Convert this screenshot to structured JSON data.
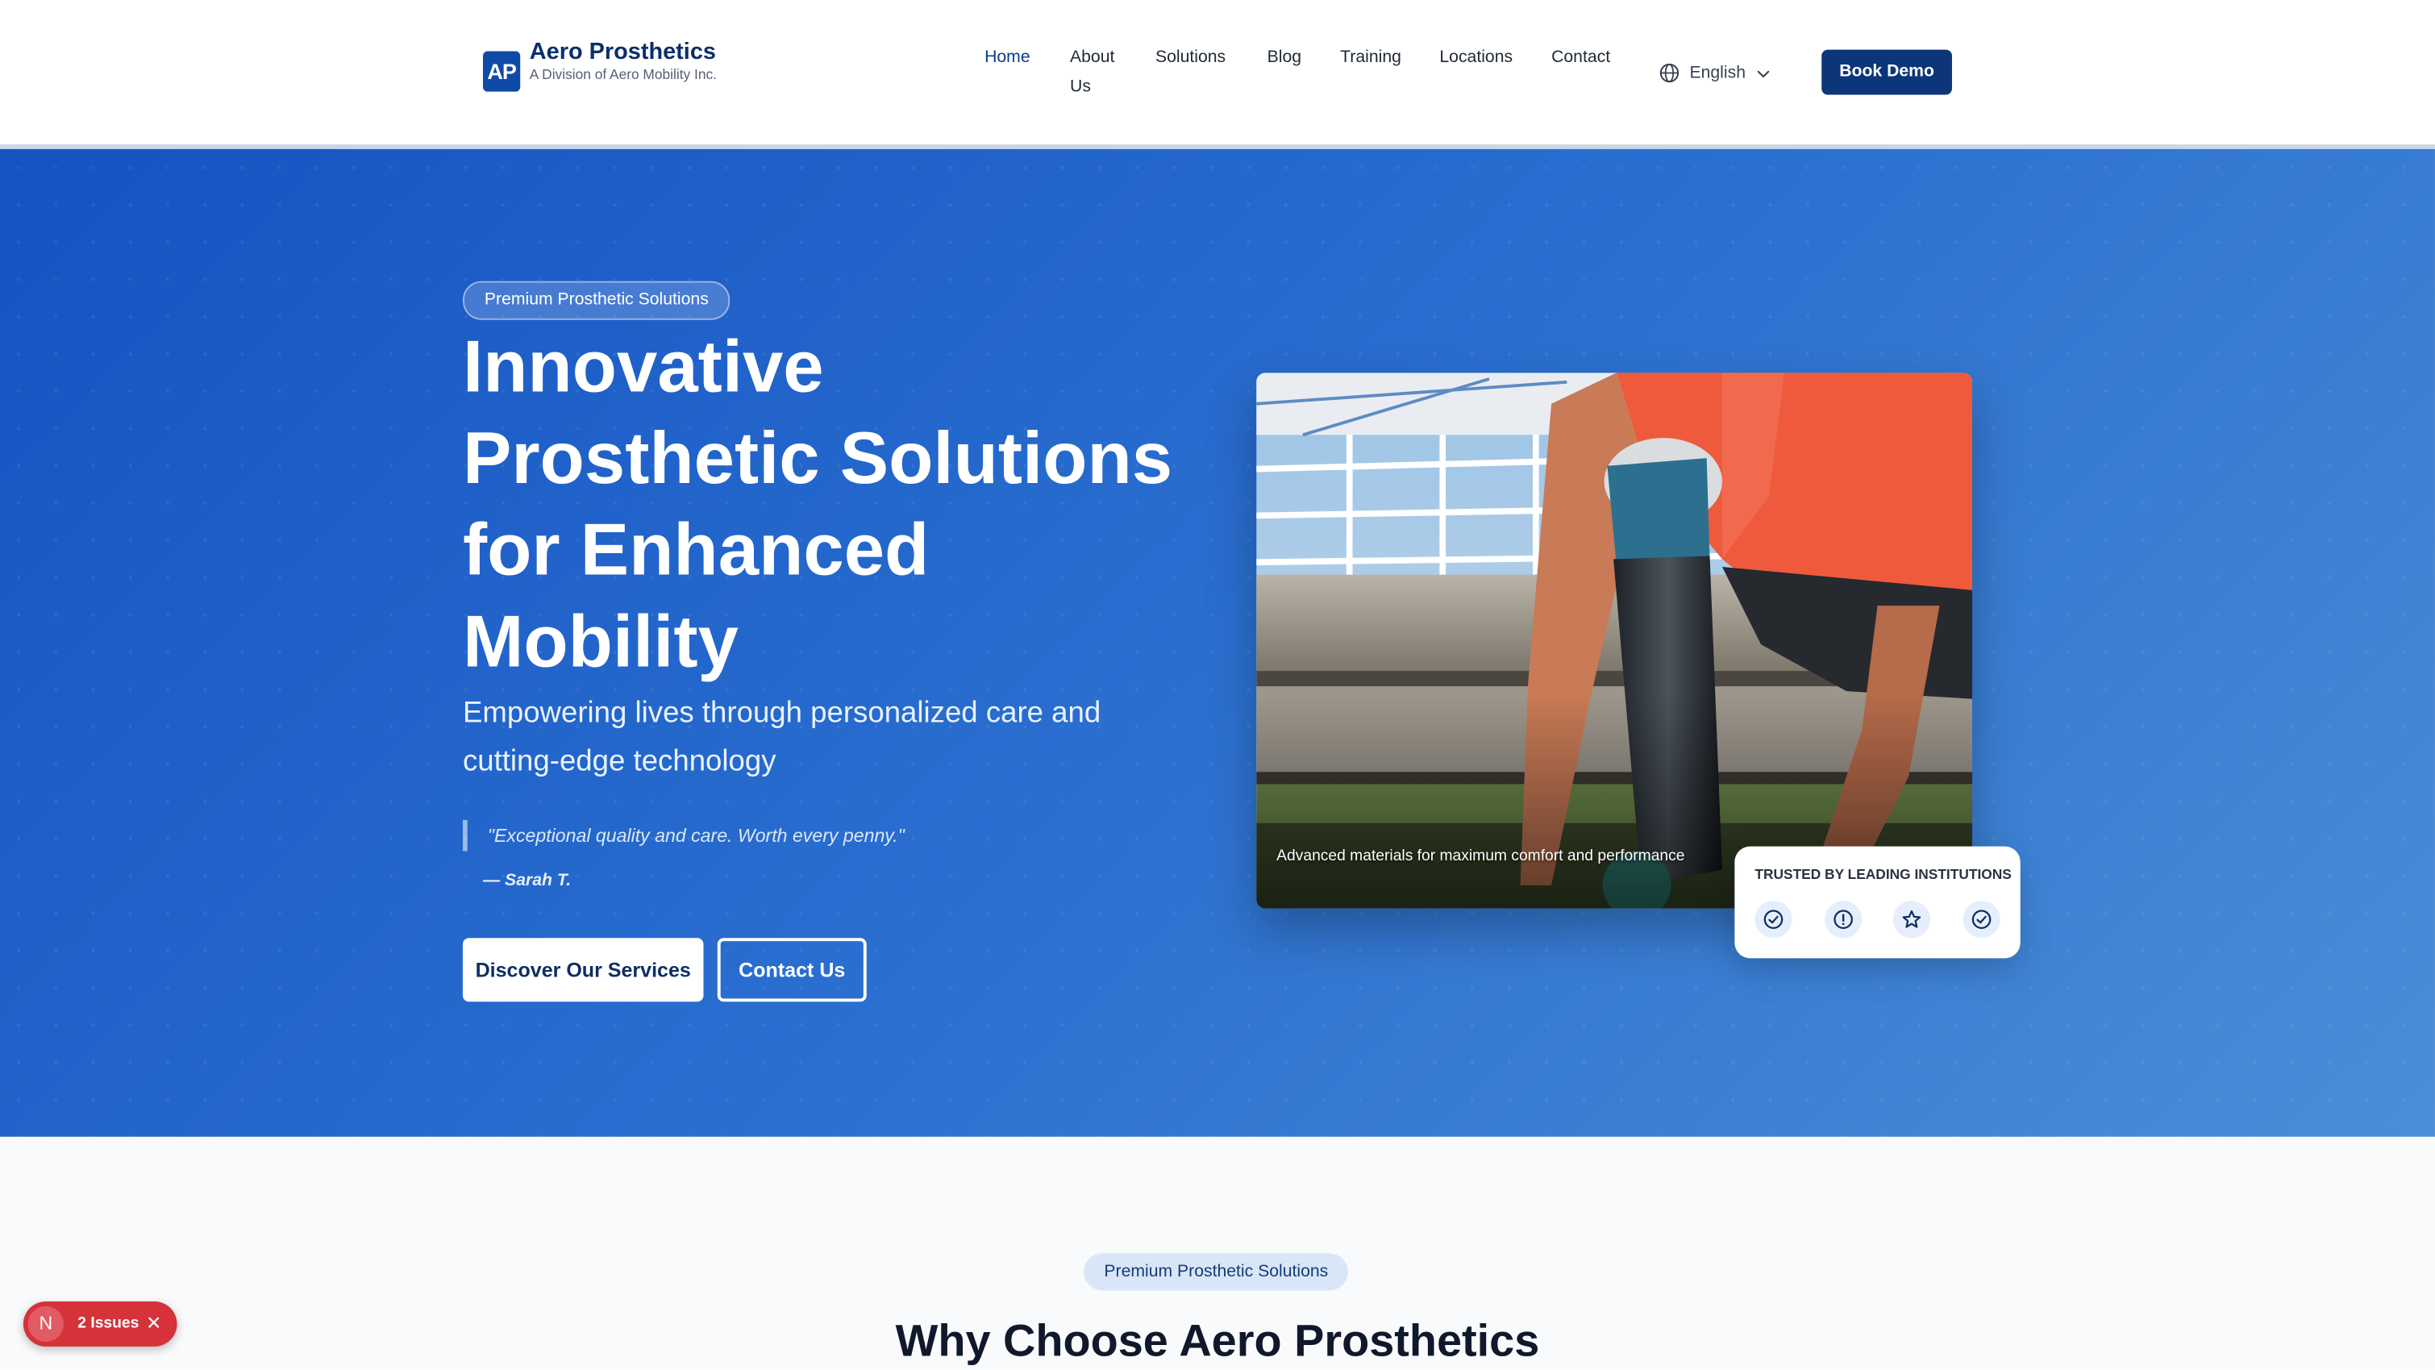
{
  "header": {
    "logo_mark": "AP",
    "brand_name": "Aero Prosthetics",
    "brand_subtitle": "A Division of Aero Mobility Inc.",
    "nav": [
      "Home",
      "About Us",
      "Solutions",
      "Blog",
      "Training",
      "Locations",
      "Contact"
    ],
    "active_nav": "Home",
    "language": "English",
    "book_demo_label": "Book Demo"
  },
  "hero": {
    "badge": "Premium Prosthetic Solutions",
    "title": "Innovative Prosthetic Solutions for Enhanced Mobility",
    "subtitle": "Empowering lives through personalized care and cutting-edge technology",
    "quote": "\"Exceptional quality and care. Worth every penny.\"",
    "quote_author": "— Sarah T.",
    "primary_button": "Discover Our Services",
    "secondary_button": "Contact Us",
    "image_caption": "Advanced materials for maximum comfort and performance",
    "trust_title": "TRUSTED BY LEADING INSTITUTIONS",
    "trust_icons": [
      "check-circle-icon",
      "info-circle-icon",
      "star-icon",
      "check-circle-icon"
    ]
  },
  "section": {
    "badge": "Premium Prosthetic Solutions",
    "title": "Why Choose Aero Prosthetics"
  },
  "dev_overlay": {
    "icon_letter": "N",
    "issues_label": "2 Issues",
    "close_glyph": "✕"
  },
  "colors": {
    "primary": "#0d357a",
    "hero_gradient_start": "#1553c1",
    "hero_gradient_end": "#4a8ed8",
    "issues_badge": "#d5323a"
  }
}
